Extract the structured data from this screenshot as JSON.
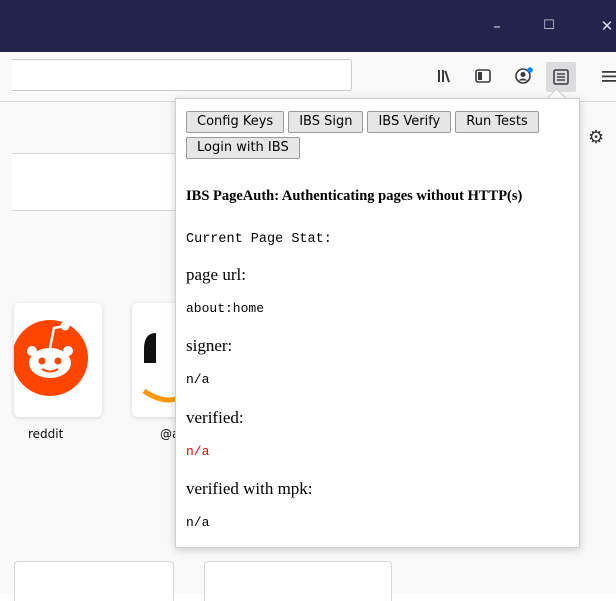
{
  "window": {
    "minimize_glyph": "–",
    "maximize_glyph": "☐",
    "close_glyph": "✕"
  },
  "toolbar": {
    "icons": [
      "library-icon",
      "sidebar-icon",
      "account-icon",
      "extension-icon",
      "menu-icon"
    ],
    "notification_color": "#0a84ff"
  },
  "newtab": {
    "settings_glyph": "⚙",
    "tiles": [
      {
        "label": "reddit",
        "icon": "reddit-logo",
        "brand_color": "#ff4500"
      },
      {
        "label": "@a",
        "icon": "amazon-logo"
      }
    ]
  },
  "popup": {
    "buttons": [
      "Config Keys",
      "IBS Sign",
      "IBS Verify",
      "Run Tests",
      "Login with IBS"
    ],
    "heading": "IBS PageAuth: Authenticating pages without HTTP(s)",
    "stat_title": "Current Page Stat:",
    "fields": [
      {
        "label": "page url:",
        "value": "about:home"
      },
      {
        "label": "signer:",
        "value": "n/a"
      },
      {
        "label": "verified:",
        "value": "n/a",
        "value_color": "#ff0000"
      },
      {
        "label": "verified with mpk:",
        "value": "n/a"
      }
    ]
  }
}
